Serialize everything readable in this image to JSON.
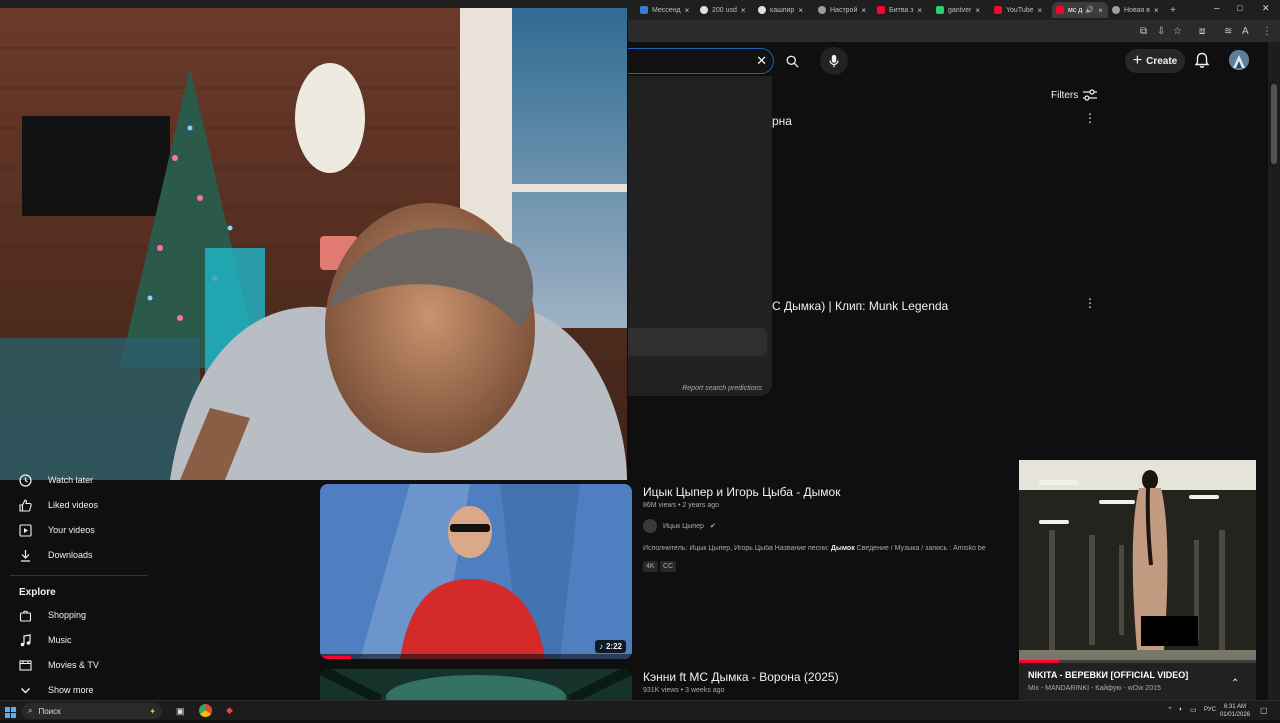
{
  "browser": {
    "tabs": [
      {
        "label": "Мессенд",
        "color": "#3a7bd5"
      },
      {
        "label": "200 usd",
        "color": "#e0e0e0"
      },
      {
        "label": "кашпир",
        "color": "#e0e0e0"
      },
      {
        "label": "Настрой",
        "color": "#9e9e9e"
      },
      {
        "label": "Битва з",
        "color": "#ff0033"
      },
      {
        "label": "gantver",
        "color": "#2ecc71"
      },
      {
        "label": "YouTube",
        "color": "#ff0033"
      },
      {
        "label": "мс д",
        "color": "#ff0033",
        "active": true
      },
      {
        "label": "Новая в",
        "color": "#9e9e9e"
      }
    ],
    "new_tab_symbol": "+",
    "window_controls": {
      "minimize": "–",
      "maximize": "□",
      "close": "✕"
    }
  },
  "youtube": {
    "search": {
      "clear_symbol": "✕"
    },
    "create_label": "Create",
    "filters_label": "Filters",
    "dropdown": {
      "report_label": "Report search predictions"
    },
    "partial_titles": [
      "рна",
      "С Дымка) | Клип: Munk Legenda"
    ],
    "sidebar": {
      "items": [
        {
          "label": "Watch later",
          "icon": "clock-icon"
        },
        {
          "label": "Liked videos",
          "icon": "thumbs-up-icon"
        },
        {
          "label": "Your videos",
          "icon": "play-square-icon"
        },
        {
          "label": "Downloads",
          "icon": "download-icon"
        }
      ],
      "explore_heading": "Explore",
      "explore_items": [
        {
          "label": "Shopping",
          "icon": "shopping-bag-icon"
        },
        {
          "label": "Music",
          "icon": "music-note-icon"
        },
        {
          "label": "Movies & TV",
          "icon": "film-icon"
        },
        {
          "label": "Show more",
          "icon": "chevron-down-icon"
        }
      ]
    },
    "results": [
      {
        "title": "Ицык Цыпер и Игорь Цыба - Дымок",
        "views": "86M views",
        "age": "2 years ago",
        "channel": "Ицык Цыпер",
        "verified": true,
        "description_pre": "Исполнитель: Ицык Цыпер, Игорь Цыба Название песни: ",
        "description_bold": "Дымок",
        "description_post": " Сведение / Музыка / запись : Amisko be",
        "badges": [
          "4K",
          "CC"
        ],
        "duration": "2:22",
        "watched_fraction": 0.1
      },
      {
        "title": "Кэнни ft МС Дымка - Ворона (2025)",
        "views": "931K views",
        "age": "3 weeks ago"
      }
    ],
    "miniplayer": {
      "title": "NIKITA - ВЕРЕВКИ [OFFICIAL VIDEO]",
      "subtitle": "Mix - MANDARINKI - Кайфую - wOw 2015",
      "progress_fraction": 0.17
    }
  },
  "taskbar": {
    "search_placeholder": "Поиск",
    "language": "РУС",
    "time": "6:31 AM",
    "date": "01/01/2026"
  }
}
